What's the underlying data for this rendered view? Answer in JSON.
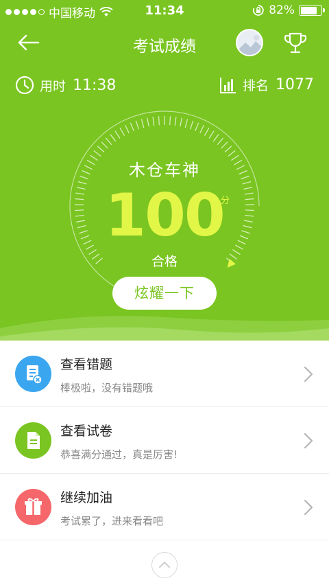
{
  "status_bar": {
    "carrier": "中国移动",
    "time": "11:34",
    "battery": "82%",
    "battery_level": 0.82
  },
  "header": {
    "title": "考试成绩"
  },
  "stats": {
    "time_label": "用时",
    "time_value": "11:38",
    "rank_label": "排名",
    "rank_value": "1077"
  },
  "gauge": {
    "nickname": "木仓车神",
    "score": "100",
    "unit": "分",
    "grade": "合格",
    "score_fraction": 1.0
  },
  "share_button": "炫耀一下",
  "list": [
    {
      "title": "查看错题",
      "subtitle": "棒极啦，没有错题哦",
      "icon": "wrong-questions-icon",
      "color": "#3ba6f0"
    },
    {
      "title": "查看试卷",
      "subtitle": "恭喜满分通过，真是厉害!",
      "icon": "paper-icon",
      "color": "#7ac521"
    },
    {
      "title": "继续加油",
      "subtitle": "考试累了，进来看看吧",
      "icon": "gift-icon",
      "color": "#f5676a"
    }
  ],
  "colors": {
    "primary": "#7ac521",
    "score": "#e1f646"
  }
}
